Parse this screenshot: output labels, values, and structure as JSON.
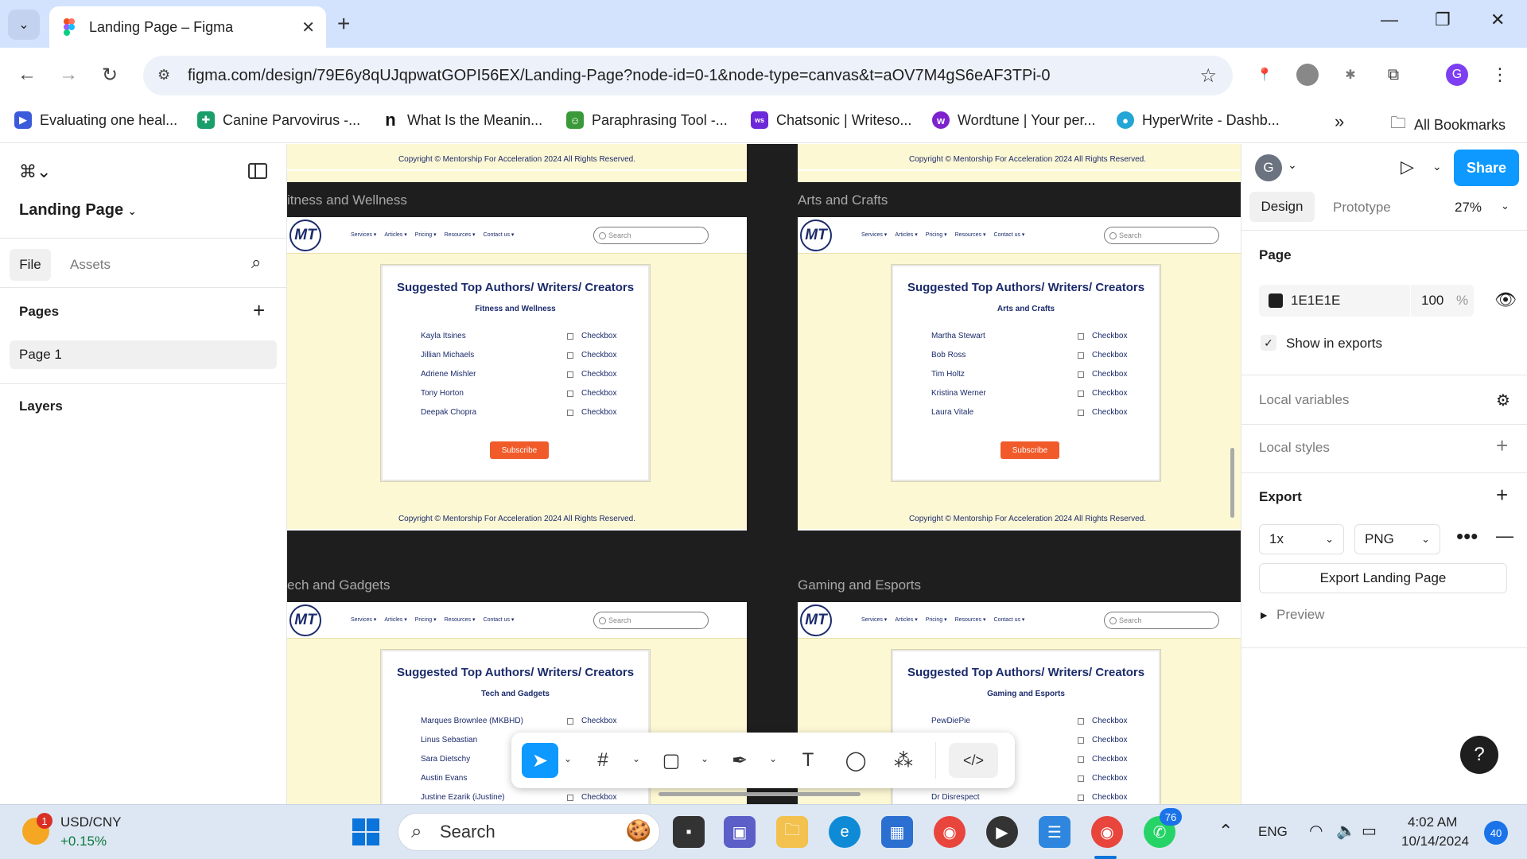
{
  "browser": {
    "tab_title": "Landing Page – Figma",
    "url": "figma.com/design/79E6y8qUJqpwatGOPI56EX/Landing-Page?node-id=0-1&node-type=canvas&t=aOV7M4gS6eAF3TPi-0",
    "bookmarks": [
      {
        "label": "Evaluating one heal...",
        "color": "#3b5bdb",
        "glyph": "▶"
      },
      {
        "label": "Canine Parvovirus -...",
        "color": "#1a9e6a",
        "glyph": "✚"
      },
      {
        "label": "What Is the Meanin...",
        "color": "#111111",
        "glyph": "n"
      },
      {
        "label": "Paraphrasing Tool -...",
        "color": "#3a9a3a",
        "glyph": "☺"
      },
      {
        "label": "Chatsonic | Writeso...",
        "color": "#6d28d9",
        "glyph": "ws"
      },
      {
        "label": "Wordtune | Your per...",
        "color": "#7e22ce",
        "glyph": "w"
      },
      {
        "label": "HyperWrite - Dashb...",
        "color": "#22a6d6",
        "glyph": "●"
      }
    ],
    "all_bookmarks": "All Bookmarks",
    "profile_initial": "G"
  },
  "figma": {
    "file_name": "Landing Page",
    "left_tabs": {
      "file": "File",
      "assets": "Assets"
    },
    "pages_label": "Pages",
    "page_item": "Page 1",
    "layers_label": "Layers",
    "right": {
      "avatar": "G",
      "share": "Share",
      "tab_design": "Design",
      "tab_prototype": "Prototype",
      "zoom": "27%",
      "page_label": "Page",
      "bg_hex": "1E1E1E",
      "bg_opacity": "100",
      "pct": "%",
      "show_in_exports": "Show in exports",
      "local_variables": "Local variables",
      "local_styles": "Local styles",
      "export_label": "Export",
      "export_scale": "1x",
      "export_format": "PNG",
      "export_button": "Export Landing Page",
      "preview": "Preview",
      "help": "?"
    }
  },
  "site": {
    "copyright": "Copyright © Mentorship For Acceleration 2024 All Rights Reserved.",
    "logo": "MT",
    "nav": [
      "Services ▾",
      "Articles ▾",
      "Pricing ▾",
      "Resources ▾",
      "Contact us ▾"
    ],
    "search_placeholder": "Search",
    "card_title": "Suggested Top Authors/ Writers/ Creators",
    "checkbox_label": "Checkbox",
    "subscribe": "Subscribe"
  },
  "frames": [
    {
      "label": "itness and Wellness",
      "sub": "Fitness and Wellness",
      "authors": [
        "Kayla Itsines",
        "Jillian Michaels",
        "Adriene Mishler",
        "Tony Horton",
        "Deepak Chopra"
      ]
    },
    {
      "label": "Arts and Crafts",
      "sub": "Arts and Crafts",
      "authors": [
        "Martha Stewart",
        "Bob Ross",
        "Tim Holtz",
        "Kristina Werner",
        "Laura Vitale"
      ]
    },
    {
      "label": "ech and Gadgets",
      "sub": "Tech and Gadgets",
      "authors": [
        "Marques Brownlee (MKBHD)",
        "Linus Sebastian",
        "Sara Dietschy",
        "Austin Evans",
        "Justine Ezarik (iJustine)"
      ]
    },
    {
      "label": "Gaming and Esports",
      "sub": "Gaming and Esports",
      "authors": [
        "PewDiePie",
        "",
        "",
        "",
        "Dr Disrespect"
      ]
    }
  ],
  "taskbar": {
    "widget_title": "USD/CNY",
    "widget_value": "+0.15%",
    "widget_badge": "1",
    "search": "Search",
    "lang": "ENG",
    "time": "4:02 AM",
    "date": "10/14/2024",
    "whatsapp_badge": "76",
    "notif_badge": "40"
  }
}
